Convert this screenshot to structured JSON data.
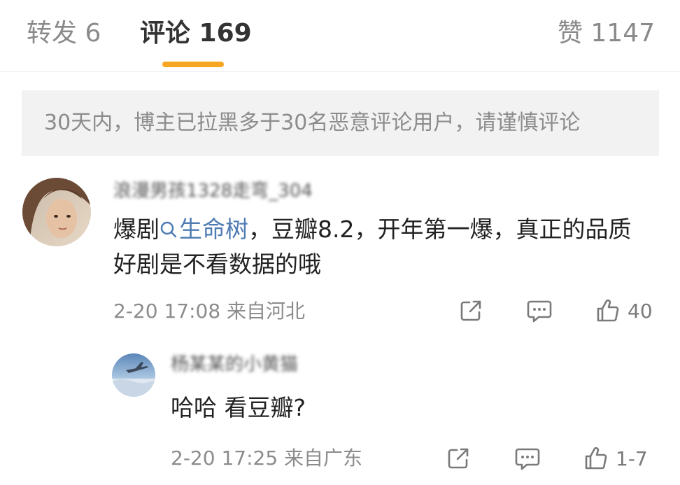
{
  "tabs": {
    "repost": "转发 6",
    "comments": "评论 169",
    "likes": "赞 1147"
  },
  "notice": "30天内，博主已拉黑多于30名恶意评论用户，请谨慎评论",
  "comment": {
    "username": "浪漫男孩1328走弯_304",
    "text_prefix": "爆剧",
    "topic": "生命树",
    "text_suffix": "，豆瓣8.2，开年第一爆，真正的品质好剧是不看数据的哦",
    "time": "2-20 17:08 来自河北",
    "like_count": "40"
  },
  "reply": {
    "username": "杨某某的小黄猫",
    "text": "哈哈 看豆瓣?",
    "time": "2-20 17:25 来自广东",
    "like_count": "1-7"
  },
  "colors": {
    "accent_indicator": "#f7a623",
    "topic_link": "#4f7bb3",
    "muted_text": "#8c8c8c",
    "notice_bg": "#f2f2f2"
  },
  "icons": {
    "share": "share-icon",
    "comment": "comment-icon",
    "like": "thumbs-up-icon",
    "topic_search": "search-icon"
  }
}
